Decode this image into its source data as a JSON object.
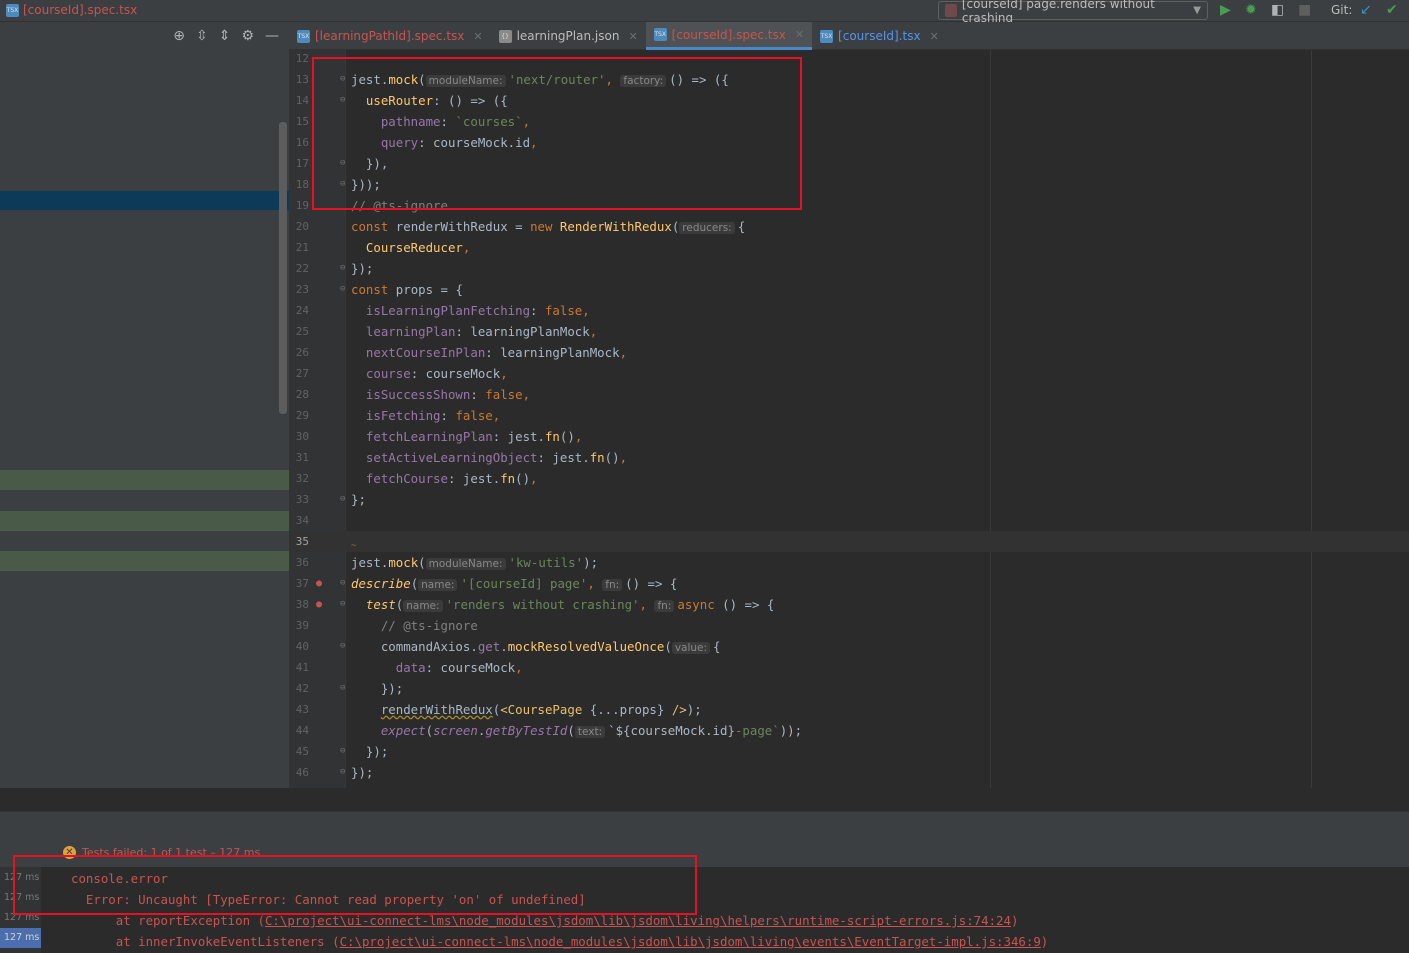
{
  "title_bar": {
    "breadcrumb_file": "[courseId].spec.tsx",
    "run_config": "[courseId] page.renders without crashing",
    "git_label": "Git:"
  },
  "tabs": [
    {
      "label": "[learningPathId].spec.tsx",
      "state": "error"
    },
    {
      "label": "learningPlan.json",
      "state": "normal"
    },
    {
      "label": "[courseId].spec.tsx",
      "state": "active-error"
    },
    {
      "label": "[courseId].tsx",
      "state": "modified"
    }
  ],
  "hints": {
    "moduleName": "moduleName:",
    "factory": "factory:",
    "reducers": "reducers:",
    "name": "name:",
    "fn": "fn:",
    "value": "value:",
    "text": "text:"
  },
  "code": {
    "l13_a": "jest.",
    "l13_b": "mock",
    "l13_c": "(",
    "l13_str": "'next/router'",
    "l13_d": ",",
    "l13_e": "() => ({",
    "l14_a": "  ",
    "l14_fn": "useRouter",
    "l14_b": ": () => ({",
    "l15_prop": "    pathname",
    "l15_b": ": ",
    "l15_str": "`courses`",
    "l15_c": ",",
    "l16_prop": "    query",
    "l16_b": ": courseMock.id",
    "l16_c": ",",
    "l17": "  }),",
    "l18": "}));",
    "l19": "// @ts-ignore",
    "l20_kw": "const",
    "l20_b": " renderWithRedux = ",
    "l20_kw2": "new",
    "l20_fn": " RenderWithRedux",
    "l20_c": "(",
    "l20_d": "{",
    "l21_fn": "  CourseReducer",
    "l21_c": ",",
    "l22": "});",
    "l23_kw": "const",
    "l23_b": " props = {",
    "props": [
      {
        "name": "  isLearningPlanFetching",
        "sep": ": ",
        "value": "false",
        "kind": "kw"
      },
      {
        "name": "  learningPlan",
        "sep": ": ",
        "value": "learningPlanMock",
        "kind": "plain"
      },
      {
        "name": "  nextCourseInPlan",
        "sep": ": ",
        "value": "learningPlanMock",
        "kind": "plain"
      },
      {
        "name": "  course",
        "sep": ": ",
        "value": "courseMock",
        "kind": "plain"
      },
      {
        "name": "  isSuccessShown",
        "sep": ": ",
        "value": "false",
        "kind": "kw"
      },
      {
        "name": "  isFetching",
        "sep": ": ",
        "value": "false",
        "kind": "kw"
      },
      {
        "name": "  fetchLearningPlan",
        "sep": ": jest.",
        "value": "fn",
        "kind": "fn"
      },
      {
        "name": "  setActiveLearningObject",
        "sep": ": jest.",
        "value": "fn",
        "kind": "fn"
      },
      {
        "name": "  fetchCourse",
        "sep": ": jest.",
        "value": "fn",
        "kind": "fn"
      }
    ],
    "call_suffix": "()",
    "comma": ",",
    "l33": "};",
    "l35_marker": "~",
    "l36_a": "jest.",
    "l36_fn": "mock",
    "l36_c": "(",
    "l36_str": "'kw-utils'",
    "l36_d": ");",
    "l37_fn": "describe",
    "l37_c": "(",
    "l37_str": "'[courseId] page'",
    "l37_d": ",",
    "l37_e": "() => {",
    "l38_fn": "  test",
    "l38_c": "(",
    "l38_str": "'renders without crashing'",
    "l38_d": ",",
    "l38_kw": "async",
    "l38_e": " () => {",
    "l39": "    // @ts-ignore",
    "l40_a": "    commandAxios.",
    "l40_prop": "get",
    "l40_b": ".",
    "l40_fn": "mockResolvedValueOnce",
    "l40_c": "(",
    "l40_d": "{",
    "l41_prop": "      data",
    "l41_b": ": courseMock",
    "l41_c": ",",
    "l42": "    });",
    "l43_a": "    ",
    "l43_fn": "renderWithRedux",
    "l43_b": "(",
    "l43_tag": "<CoursePage",
    "l43_c": " {...props} ",
    "l43_tag2": "/>",
    "l43_d": ");",
    "l44_a": "    ",
    "l44_fn": "expect",
    "l44_b": "(",
    "l44_fn2": "screen",
    "l44_c": ".",
    "l44_fn3": "getByTestId",
    "l44_d": "(",
    "l44_e": "`${courseMock.id}",
    "l44_str": "-page`",
    "l44_f": "));",
    "l45": "  });",
    "l46": "});"
  },
  "line_numbers": [
    "12",
    "13",
    "14",
    "15",
    "16",
    "17",
    "18",
    "19",
    "20",
    "21",
    "22",
    "23",
    "24",
    "25",
    "26",
    "27",
    "28",
    "29",
    "30",
    "31",
    "32",
    "33",
    "34",
    "35",
    "36",
    "37",
    "38",
    "39",
    "40",
    "41",
    "42",
    "43",
    "44",
    "45",
    "46"
  ],
  "status": {
    "text": "Tests failed: 1 of 1 test – 127 ms"
  },
  "console": {
    "durations": [
      "127 ms",
      "127 ms",
      "127 ms",
      "127 ms"
    ],
    "line1": "console.error",
    "line2": "  Error: Uncaught [TypeError: Cannot read property 'on' of undefined]",
    "line3_prefix": "      at reportException (",
    "line3_path": "C:\\project\\ui-connect-lms\\node_modules\\jsdom\\lib\\jsdom\\living\\helpers\\runtime-script-errors.js:74:24",
    "line3_suffix": ")",
    "line4_prefix": "      at innerInvokeEventListeners (",
    "line4_path": "C:\\project\\ui-connect-lms\\node_modules\\jsdom\\lib\\jsdom\\living\\events\\EventTarget-impl.js:346:9",
    "line4_suffix": ")"
  },
  "colors": {
    "highlight_box": "#e81123",
    "error_text": "#c75450",
    "keyword": "#cc7832",
    "string": "#6a8759",
    "property": "#9876aa",
    "function": "#ffc66d"
  },
  "icons": [
    "tsx-file-icon",
    "json-file-icon",
    "run-icon",
    "debug-icon",
    "coverage-icon",
    "stop-icon",
    "git-update-icon",
    "git-commit-icon",
    "crosshair-icon",
    "expand-all-icon",
    "collapse-all-icon",
    "gear-icon",
    "minimize-icon",
    "error-circle-icon",
    "test-failed-gutter-icon"
  ]
}
